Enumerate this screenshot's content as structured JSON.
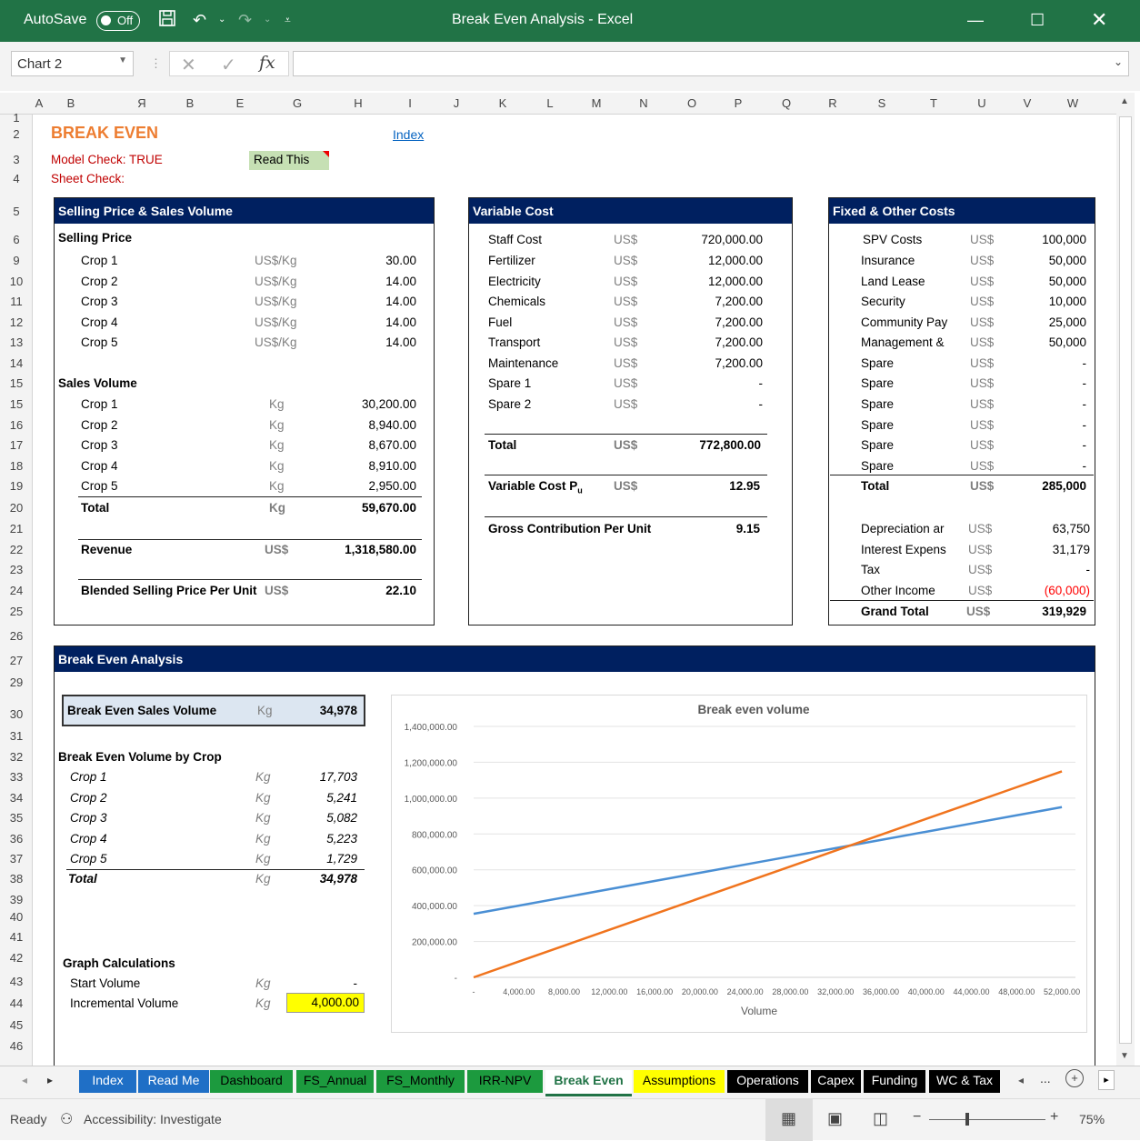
{
  "titlebar": {
    "autosave": "AutoSave",
    "toggle": "Off",
    "title": "Break Even Analysis  -  Excel"
  },
  "formula": {
    "namebox": "Chart 2",
    "fx": "fx"
  },
  "columns": [
    "A",
    "B",
    "Я",
    "B",
    "E",
    "G",
    "H",
    "I",
    "J",
    "K",
    "L",
    "M",
    "N",
    "O",
    "P",
    "Q",
    "R",
    "S",
    "T",
    "U",
    "V",
    "W"
  ],
  "rows": [
    "1",
    "2",
    "3",
    "4",
    "5",
    "6",
    "9",
    "10",
    "11",
    "12",
    "13",
    "14",
    "15",
    "15",
    "16",
    "17",
    "18",
    "19",
    "20",
    "21",
    "22",
    "23",
    "24",
    "25",
    "26",
    "27",
    "29",
    "30",
    "31",
    "32",
    "33",
    "34",
    "35",
    "36",
    "37",
    "38",
    "39",
    "40",
    "41",
    "42",
    "43",
    "44",
    "45",
    "46"
  ],
  "header": {
    "title": "BREAK EVEN",
    "index_link": "Index",
    "model_check": "Model Check: TRUE",
    "sheet_check": "Sheet Check:",
    "read_this": "Read This"
  },
  "selling": {
    "head": "Selling Price & Sales Volume",
    "price_label": "Selling Price",
    "prices": [
      [
        "Crop 1",
        "US$/Kg",
        "30.00"
      ],
      [
        "Crop 2",
        "US$/Kg",
        "14.00"
      ],
      [
        "Crop 3",
        "US$/Kg",
        "14.00"
      ],
      [
        "Crop 4",
        "US$/Kg",
        "14.00"
      ],
      [
        "Crop 5",
        "US$/Kg",
        "14.00"
      ]
    ],
    "vol_label": "Sales Volume",
    "volumes": [
      [
        "Crop 1",
        "Kg",
        "30,200.00"
      ],
      [
        "Crop 2",
        "Kg",
        "8,940.00"
      ],
      [
        "Crop 3",
        "Kg",
        "8,670.00"
      ],
      [
        "Crop 4",
        "Kg",
        "8,910.00"
      ],
      [
        "Crop 5",
        "Kg",
        "2,950.00"
      ]
    ],
    "total": [
      "Total",
      "Kg",
      "59,670.00"
    ],
    "revenue": [
      "Revenue",
      "US$",
      "1,318,580.00"
    ],
    "blended": [
      "Blended Selling Price Per Unit",
      "US$",
      "22.10"
    ]
  },
  "variable": {
    "head": "Variable Cost",
    "items": [
      [
        "Staff Cost",
        "US$",
        "720,000.00"
      ],
      [
        "Fertilizer",
        "US$",
        "12,000.00"
      ],
      [
        "Electricity",
        "US$",
        "12,000.00"
      ],
      [
        "Chemicals",
        "US$",
        "7,200.00"
      ],
      [
        "Fuel",
        "US$",
        "7,200.00"
      ],
      [
        "Transport",
        "US$",
        "7,200.00"
      ],
      [
        "Maintenance",
        "US$",
        "7,200.00"
      ],
      [
        "Spare 1",
        "US$",
        "-"
      ],
      [
        "Spare 2",
        "US$",
        "-"
      ]
    ],
    "total": [
      "Total",
      "US$",
      "772,800.00"
    ],
    "per_unit": [
      "Variable Cost Pu",
      "US$",
      "12.95"
    ],
    "gross": [
      "Gross Contribution Per Unit",
      "9.15"
    ]
  },
  "fixed": {
    "head": "Fixed & Other Costs",
    "items": [
      [
        "SPV Costs",
        "US$",
        "100,000"
      ],
      [
        "Insurance",
        "US$",
        "50,000"
      ],
      [
        "Land Lease",
        "US$",
        "50,000"
      ],
      [
        "Security",
        "US$",
        "10,000"
      ],
      [
        "Community Pay",
        "US$",
        "25,000"
      ],
      [
        "Management &",
        "US$",
        "50,000"
      ],
      [
        "Spare",
        "US$",
        "-"
      ],
      [
        "Spare",
        "US$",
        "-"
      ],
      [
        "Spare",
        "US$",
        "-"
      ],
      [
        "Spare",
        "US$",
        "-"
      ],
      [
        "Spare",
        "US$",
        "-"
      ],
      [
        "Spare",
        "US$",
        "-"
      ]
    ],
    "total": [
      "Total",
      "US$",
      "285,000"
    ],
    "other": [
      [
        "Depreciation ar",
        "US$",
        "63,750"
      ],
      [
        "Interest Expens",
        "US$",
        "31,179"
      ],
      [
        "Tax",
        "US$",
        "-"
      ],
      [
        "Other Income",
        "US$",
        "(60,000)"
      ]
    ],
    "grand": [
      "Grand Total",
      "US$",
      "319,929"
    ]
  },
  "bea": {
    "head": "Break Even Analysis",
    "sales": [
      "Break Even Sales Volume",
      "Kg",
      "34,978"
    ],
    "by_crop_label": "Break Even Volume by Crop",
    "crops": [
      [
        "Crop 1",
        "Kg",
        "17,703"
      ],
      [
        "Crop 2",
        "Kg",
        "5,241"
      ],
      [
        "Crop 3",
        "Kg",
        "5,082"
      ],
      [
        "Crop 4",
        "Kg",
        "5,223"
      ],
      [
        "Crop 5",
        "Kg",
        "1,729"
      ]
    ],
    "total": [
      "Total",
      "Kg",
      "34,978"
    ],
    "graph_label": "Graph Calculations",
    "start": [
      "Start Volume",
      "Kg",
      "-"
    ],
    "incr": [
      "Incremental Volume",
      "Kg",
      "4,000.00"
    ]
  },
  "chart_data": {
    "type": "line",
    "title": "Break even volume",
    "xlabel": "Volume",
    "ylabel": "",
    "x": [
      0,
      4000,
      8000,
      12000,
      16000,
      20000,
      24000,
      28000,
      32000,
      36000,
      40000,
      44000,
      48000,
      52000
    ],
    "x_ticks": [
      "-",
      "4,000.00",
      "8,000.00",
      "12,000.00",
      "16,000.00",
      "20,000.00",
      "24,000.00",
      "28,000.00",
      "32,000.00",
      "36,000.00",
      "40,000.00",
      "44,000.00",
      "48,000.00",
      "52,000.00"
    ],
    "y_ticks": [
      "-",
      "200,000.00",
      "400,000.00",
      "600,000.00",
      "800,000.00",
      "1,000,000.00",
      "1,200,000.00",
      "1,400,000.00"
    ],
    "ylim": [
      0,
      1400000
    ],
    "xlim": [
      0,
      53200
    ],
    "series": [
      {
        "color": "#4a8fd4",
        "values": [
          354430,
          400230,
          446030,
          491830,
          537630,
          583430,
          629230,
          675030,
          720830,
          766630,
          812430,
          858230,
          904030,
          949830
        ]
      },
      {
        "color": "#f0741e",
        "values": [
          0,
          88400,
          176800,
          265200,
          353600,
          442000,
          530400,
          618800,
          707200,
          795600,
          884000,
          972400,
          1060800,
          1149200
        ]
      }
    ],
    "grid": true,
    "legend": "none"
  },
  "tabs": [
    {
      "label": "Index",
      "bg": "#1f6fc6",
      "fg": "#fff"
    },
    {
      "label": "Read Me",
      "bg": "#1f6fc6",
      "fg": "#fff"
    },
    {
      "label": "Dashboard",
      "bg": "#1c9a3e",
      "fg": "#000"
    },
    {
      "label": "FS_Annual",
      "bg": "#1c9a3e",
      "fg": "#000"
    },
    {
      "label": "FS_Monthly",
      "bg": "#1c9a3e",
      "fg": "#000"
    },
    {
      "label": "IRR-NPV",
      "bg": "#1c9a3e",
      "fg": "#000"
    },
    {
      "label": "Break Even",
      "bg": "#ffffff",
      "fg": "#217346"
    },
    {
      "label": "Assumptions",
      "bg": "#ffff00",
      "fg": "#000"
    },
    {
      "label": "Operations",
      "bg": "#000000",
      "fg": "#fff"
    },
    {
      "label": "Capex",
      "bg": "#000000",
      "fg": "#fff"
    },
    {
      "label": "Funding",
      "bg": "#000000",
      "fg": "#fff"
    },
    {
      "label": "WC & Tax",
      "bg": "#000000",
      "fg": "#fff"
    }
  ],
  "status": {
    "ready": "Ready",
    "access": "Accessibility: Investigate",
    "zoom": "75%"
  }
}
